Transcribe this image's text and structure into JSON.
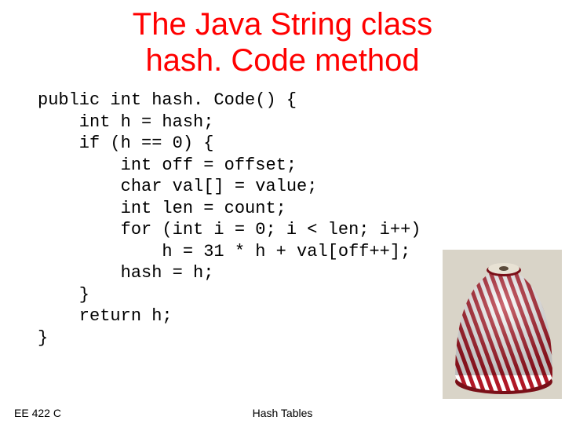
{
  "title_line1": "The Java String class",
  "title_line2": "hash. Code method",
  "code": "public int hash. Code() {\n    int h = hash;\n    if (h == 0) {\n        int off = offset;\n        char val[] = value;\n        int len = count;\n        for (int i = 0; i < len; i++)\n            h = 31 * h + val[off++];\n        hash = h;\n    }\n    return h;\n}",
  "footer": {
    "course": "EE 422 C",
    "topic": "Hash Tables"
  },
  "image": {
    "name": "spool-of-twine-image",
    "colors": {
      "primary": "#b01826",
      "secondary": "#ffffff",
      "shadow": "#7a0f18",
      "bg": "#d9d4c8"
    }
  }
}
